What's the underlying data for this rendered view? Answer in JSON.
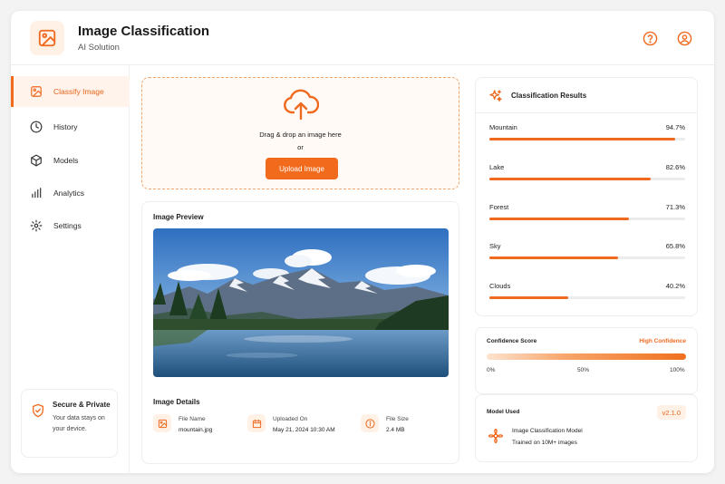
{
  "header": {
    "title": "Image Classification",
    "subtitle": "AI Solution",
    "icons": [
      "image-icon",
      "help-icon",
      "user-icon"
    ]
  },
  "sidebar": {
    "items": [
      {
        "label": "Classify Image",
        "icon": "image-icon",
        "active": true
      },
      {
        "label": "History",
        "icon": "clock-icon",
        "active": false
      },
      {
        "label": "Models",
        "icon": "cube-icon",
        "active": false
      },
      {
        "label": "Analytics",
        "icon": "bar-chart-icon",
        "active": false
      },
      {
        "label": "Settings",
        "icon": "gear-icon",
        "active": false
      }
    ],
    "secure": {
      "title": "Secure & Private",
      "text": "Your data stays on your device."
    }
  },
  "upload": {
    "drag_text": "Drag & drop an image here",
    "or_text": "or",
    "button_label": "Upload Image"
  },
  "preview": {
    "title": "Image Preview",
    "details_title": "Image Details",
    "details": [
      {
        "label": "File Name",
        "value": "mountain.jpg",
        "icon": "image-icon"
      },
      {
        "label": "Uploaded On",
        "value": "May 21, 2024 10:30 AM",
        "icon": "calendar-icon"
      },
      {
        "label": "File Size",
        "value": "2.4 MB",
        "icon": "info-icon"
      }
    ]
  },
  "results": {
    "title": "Classification Results",
    "items": [
      {
        "label": "Mountain",
        "value": "94.7%",
        "fraction": 0.947
      },
      {
        "label": "Lake",
        "value": "82.6%",
        "fraction": 0.826
      },
      {
        "label": "Forest",
        "value": "71.3%",
        "fraction": 0.713
      },
      {
        "label": "Sky",
        "value": "65.8%",
        "fraction": 0.658
      },
      {
        "label": "Clouds",
        "value": "40.2%",
        "fraction": 0.402
      }
    ]
  },
  "confidence": {
    "label": "Confidence Score",
    "status": "High Confidence",
    "ticks": [
      "0%",
      "50%",
      "100%"
    ]
  },
  "model": {
    "label": "Model Used",
    "version": "v2.1.0",
    "name": "Image Classification Model",
    "description": "Trained on 10M+ images"
  },
  "colors": {
    "accent": "#f26b1d",
    "accent_light": "#fff1e6",
    "border": "#eeeeee"
  }
}
